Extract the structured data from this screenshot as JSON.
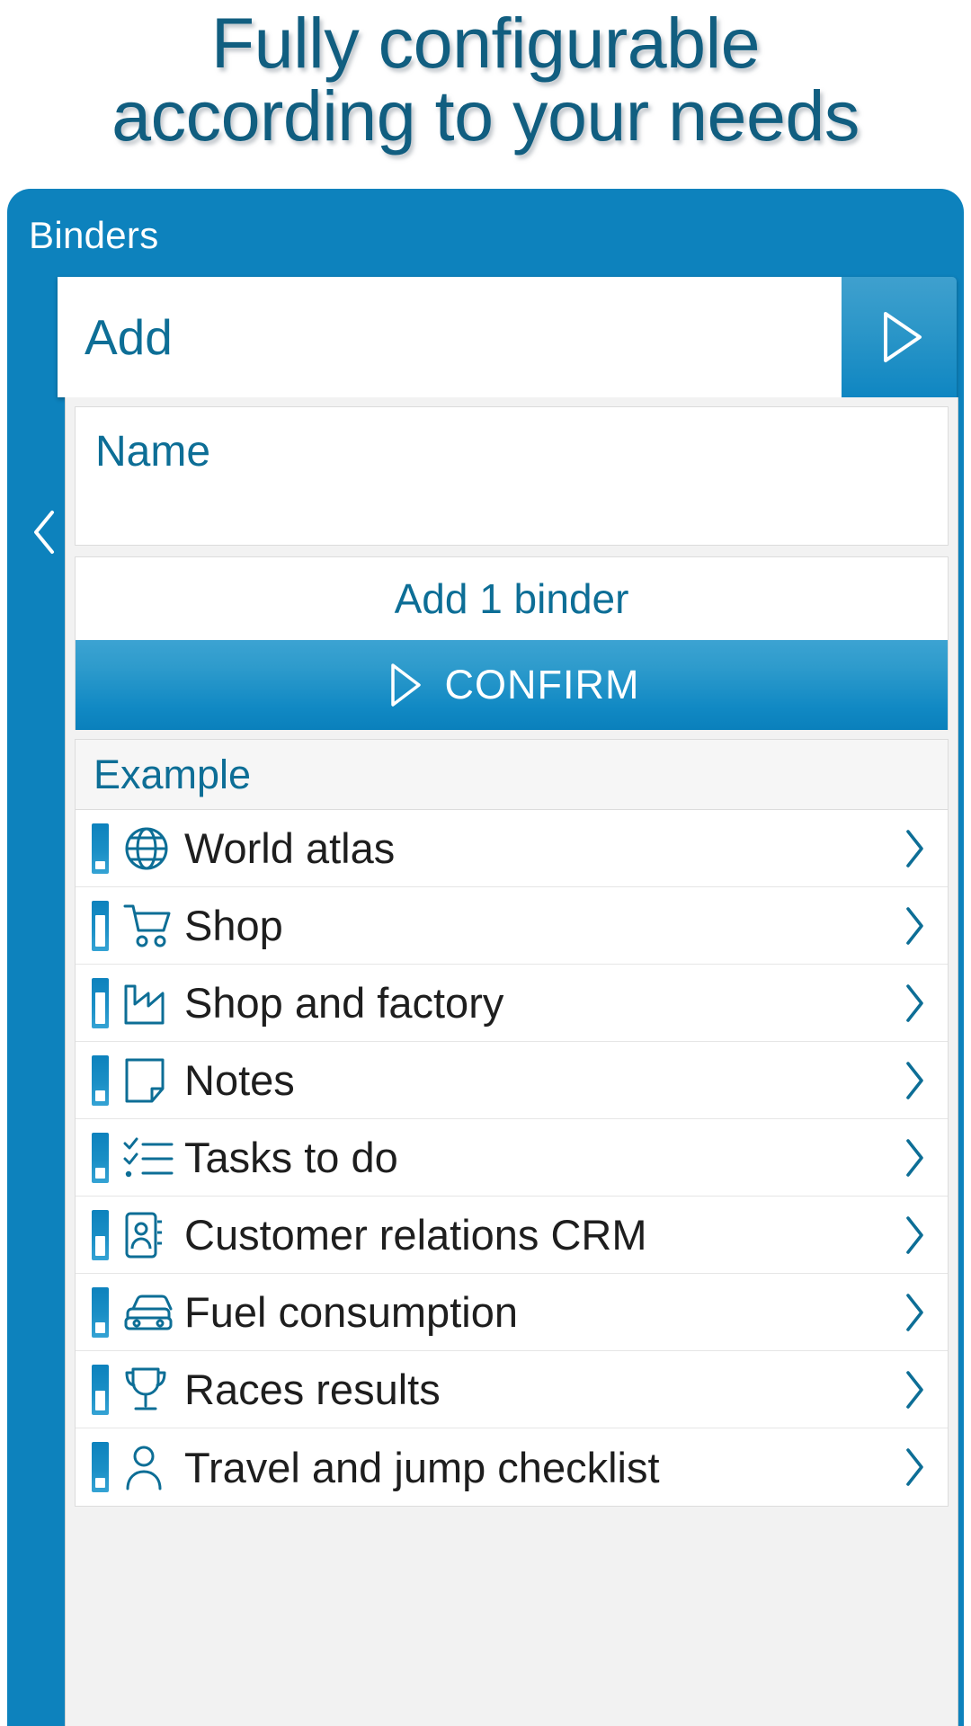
{
  "headline": "Fully configurable\naccording to your needs",
  "app": {
    "title": "Binders",
    "back_icon": "chevron-left-icon"
  },
  "add_bar": {
    "label": "Add",
    "go_icon": "play-triangle-icon"
  },
  "form": {
    "name_label": "Name",
    "add_count_label": "Add 1 binder",
    "confirm_label": "CONFIRM",
    "confirm_icon": "play-triangle-icon"
  },
  "section": {
    "header": "Example",
    "items": [
      {
        "label": "World atlas",
        "icon": "globe-icon",
        "fill": 16
      },
      {
        "label": "Shop",
        "icon": "shopping-cart-icon",
        "fill": 62
      },
      {
        "label": "Shop and factory",
        "icon": "factory-icon",
        "fill": 62
      },
      {
        "label": "Notes",
        "icon": "note-page-icon",
        "fill": 20
      },
      {
        "label": "Tasks to do",
        "icon": "checklist-icon",
        "fill": 20
      },
      {
        "label": "Customer relations CRM",
        "icon": "contact-book-icon",
        "fill": 38
      },
      {
        "label": "Fuel consumption",
        "icon": "car-icon",
        "fill": 20
      },
      {
        "label": "Races results",
        "icon": "trophy-icon",
        "fill": 38
      },
      {
        "label": "Travel and jump checklist",
        "icon": "person-icon",
        "fill": 20
      }
    ],
    "chevron_icon": "chevron-right-icon"
  },
  "colors": {
    "brand_blue": "#0d82bd",
    "deep_blue": "#115e80",
    "icon_blue": "#0d6e96",
    "panel_bg": "#f2f2f2"
  }
}
